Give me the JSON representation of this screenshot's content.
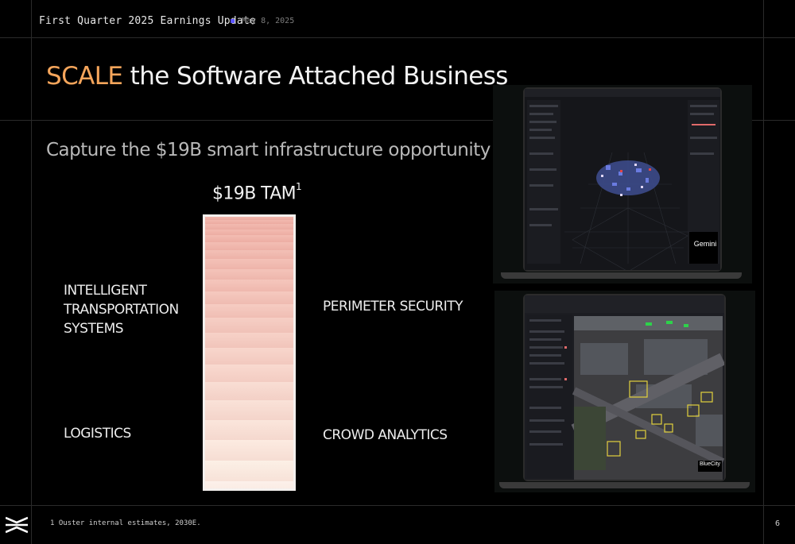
{
  "header": {
    "title": "First Quarter 2025 Earnings Update",
    "date": "May 8, 2025"
  },
  "slide": {
    "title_accent": "SCALE",
    "title_rest": " the Software Attached Business",
    "subtitle": "Capture the $19B smart infrastructure opportunity",
    "tam_label": "$19B TAM",
    "tam_footnote_ref": "1",
    "segments": {
      "its": [
        "INTELLIGENT",
        "TRANSPORTATION",
        "SYSTEMS"
      ],
      "perimeter": "PERIMETER SECURITY",
      "logistics": "LOGISTICS",
      "crowd": "CROWD ANALYTICS"
    },
    "screens": {
      "top_badge": "Gemini",
      "bottom_badge": "BlueCity"
    }
  },
  "footer": {
    "footnote": "1 Ouster internal estimates, 2030E.",
    "page_number": "6"
  },
  "colors": {
    "accent": "#f5a55b",
    "marker": "#5b54ff",
    "bar_fill": "#f7dcd6"
  }
}
